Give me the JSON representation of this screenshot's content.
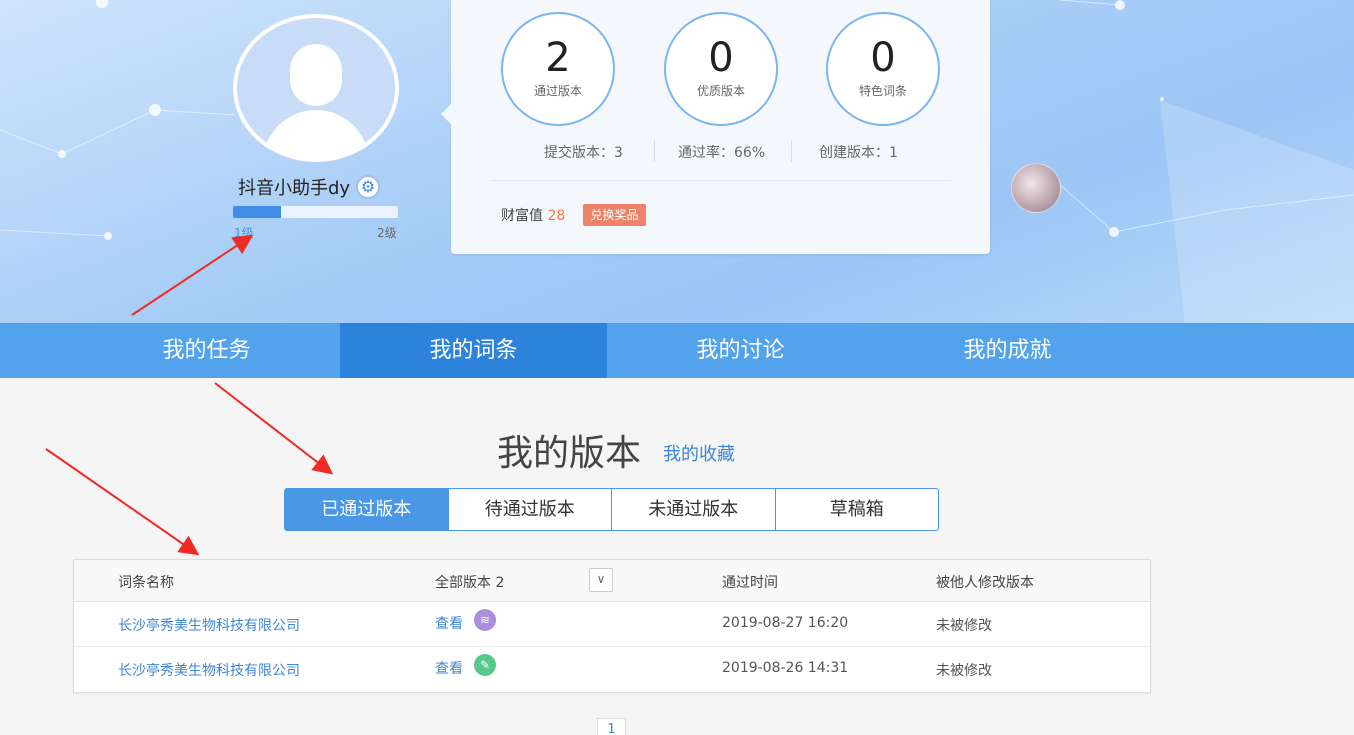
{
  "profile": {
    "username": "抖音小助手dy",
    "level_min": "1级",
    "level_max": "2级",
    "level_progress": 0.29
  },
  "stats": {
    "passed": {
      "value": "2",
      "label": "通过版本"
    },
    "quality": {
      "value": "0",
      "label": "优质版本"
    },
    "featured": {
      "value": "0",
      "label": "特色词条"
    },
    "submitted": "提交版本：3",
    "pass_rate": "通过率：66%",
    "created": "创建版本：1",
    "wealth_label": "财富值",
    "wealth_value": "28",
    "exchange_button": "兑换奖品"
  },
  "nav": {
    "items": [
      "我的任务",
      "我的词条",
      "我的讨论",
      "我的成就"
    ],
    "active": 1
  },
  "section": {
    "title": "我的版本",
    "favorites_link": "我的收藏"
  },
  "tabs": [
    "已通过版本",
    "待通过版本",
    "未通过版本",
    "草稿箱"
  ],
  "table": {
    "headers": [
      "词条名称",
      "全部版本 2",
      "通过时间",
      "被他人修改版本"
    ],
    "rows": [
      {
        "name": "长沙亭秀美生物科技有限公司",
        "action": "查看",
        "badge": "layers-icon",
        "time": "2019-08-27 16:20",
        "modified": "未被修改"
      },
      {
        "name": "长沙亭秀美生物科技有限公司",
        "action": "查看",
        "badge": "edit-icon",
        "time": "2019-08-26 14:31",
        "modified": "未被修改"
      }
    ]
  },
  "pagination": {
    "current": "1"
  },
  "colors": {
    "nav": "#52a3ec",
    "nav_active": "#2d83db",
    "link": "#3d86d6",
    "accent_orange": "#f07b35",
    "arrow": "#ee2b24"
  }
}
